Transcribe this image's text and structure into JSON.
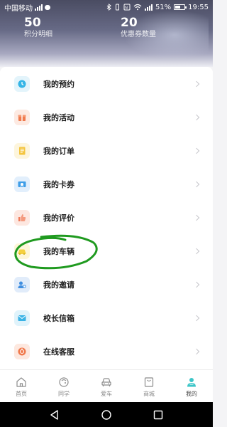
{
  "status_bar": {
    "carrier": "中国移动",
    "battery": "51%",
    "time": "19:55"
  },
  "header": {
    "stats": [
      {
        "value": "50",
        "label": "积分明细"
      },
      {
        "value": "20",
        "label": "优惠券数量"
      }
    ]
  },
  "menu": {
    "items": [
      {
        "label": "我的预约",
        "icon": "clock-icon",
        "color": "#35b5e6"
      },
      {
        "label": "我的活动",
        "icon": "gift-icon",
        "color": "#f07a4d"
      },
      {
        "label": "我的订单",
        "icon": "order-icon",
        "color": "#f4c540"
      },
      {
        "label": "我的卡券",
        "icon": "coupon-icon",
        "color": "#3f9ee8"
      },
      {
        "label": "我的评价",
        "icon": "thumb-icon",
        "color": "#f07a5a"
      },
      {
        "label": "我的车辆",
        "icon": "car-icon",
        "color": "#f4d040"
      },
      {
        "label": "我的邀请",
        "icon": "invite-icon",
        "color": "#3f8ee0"
      },
      {
        "label": "校长信箱",
        "icon": "mailbox-icon",
        "color": "#3ab3e6"
      },
      {
        "label": "在线客服",
        "icon": "service-icon",
        "color": "#f07a4d"
      }
    ]
  },
  "tabbar": {
    "tabs": [
      {
        "label": "首页",
        "icon": "home-icon"
      },
      {
        "label": "同学",
        "icon": "classmate-icon"
      },
      {
        "label": "爱车",
        "icon": "car-front-icon"
      },
      {
        "label": "商城",
        "icon": "shop-icon"
      },
      {
        "label": "我的",
        "icon": "person-icon"
      }
    ],
    "active_index": 4,
    "active_color": "#3ec6c8"
  }
}
